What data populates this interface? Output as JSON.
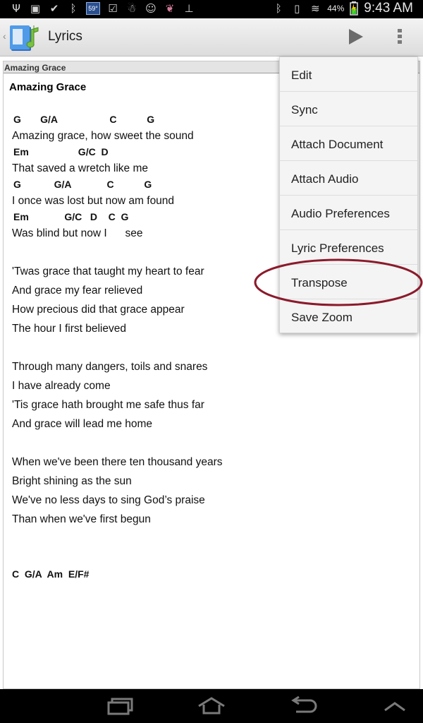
{
  "status_bar": {
    "icons_left": [
      "usb-icon",
      "image-icon",
      "check-circle-icon",
      "bluetooth-small-icon",
      "weather-icon",
      "message-icon",
      "ghost-icon",
      "smiley-icon",
      "gift-icon",
      "download-icon"
    ],
    "weather_temp": "59°",
    "battery_pct": "44%",
    "time": "9:43 AM"
  },
  "action_bar": {
    "title": "Lyrics",
    "icons": [
      "app-icon",
      "play-icon",
      "overflow-icon"
    ]
  },
  "document": {
    "bar_label": "Amazing Grace",
    "song_title": "Amazing Grace",
    "verse1": [
      {
        "chords": "G       G/A                   C           G",
        "lyric": "Amazing grace, how sweet the sound"
      },
      {
        "chords": "Em                  G/C  D",
        "lyric": "That saved a wretch like me"
      },
      {
        "chords": "G            G/A             C           G",
        "lyric": "I once was lost but now am found"
      },
      {
        "chords": "Em             G/C   D    C  G",
        "lyric": "Was blind but now I      see"
      }
    ],
    "verse2": [
      "'Twas grace that taught my heart to fear",
      "And grace my fear relieved",
      "How precious did that grace appear",
      "The hour I first believed"
    ],
    "verse3": [
      "Through many dangers, toils and snares",
      "I have already come",
      "'Tis grace hath brought me safe thus far",
      "And grace will lead me home"
    ],
    "verse4": [
      "When we've been there ten thousand years",
      "Bright shining as the sun",
      "We've no less days to sing God’s praise",
      "Than when we've first begun"
    ],
    "chord_footer": "C  G/A  Am  E/F#"
  },
  "menu": {
    "items": [
      "Edit",
      "Sync",
      "Attach Document",
      "Attach Audio",
      "Audio Preferences",
      "Lyric Preferences",
      "Transpose",
      "Save Zoom"
    ],
    "highlighted": "Transpose",
    "highlight_color": "#8b1a2b"
  },
  "nav_bar": {
    "icons": [
      "recent-apps-icon",
      "home-icon",
      "back-icon",
      "up-chevron-icon"
    ]
  }
}
